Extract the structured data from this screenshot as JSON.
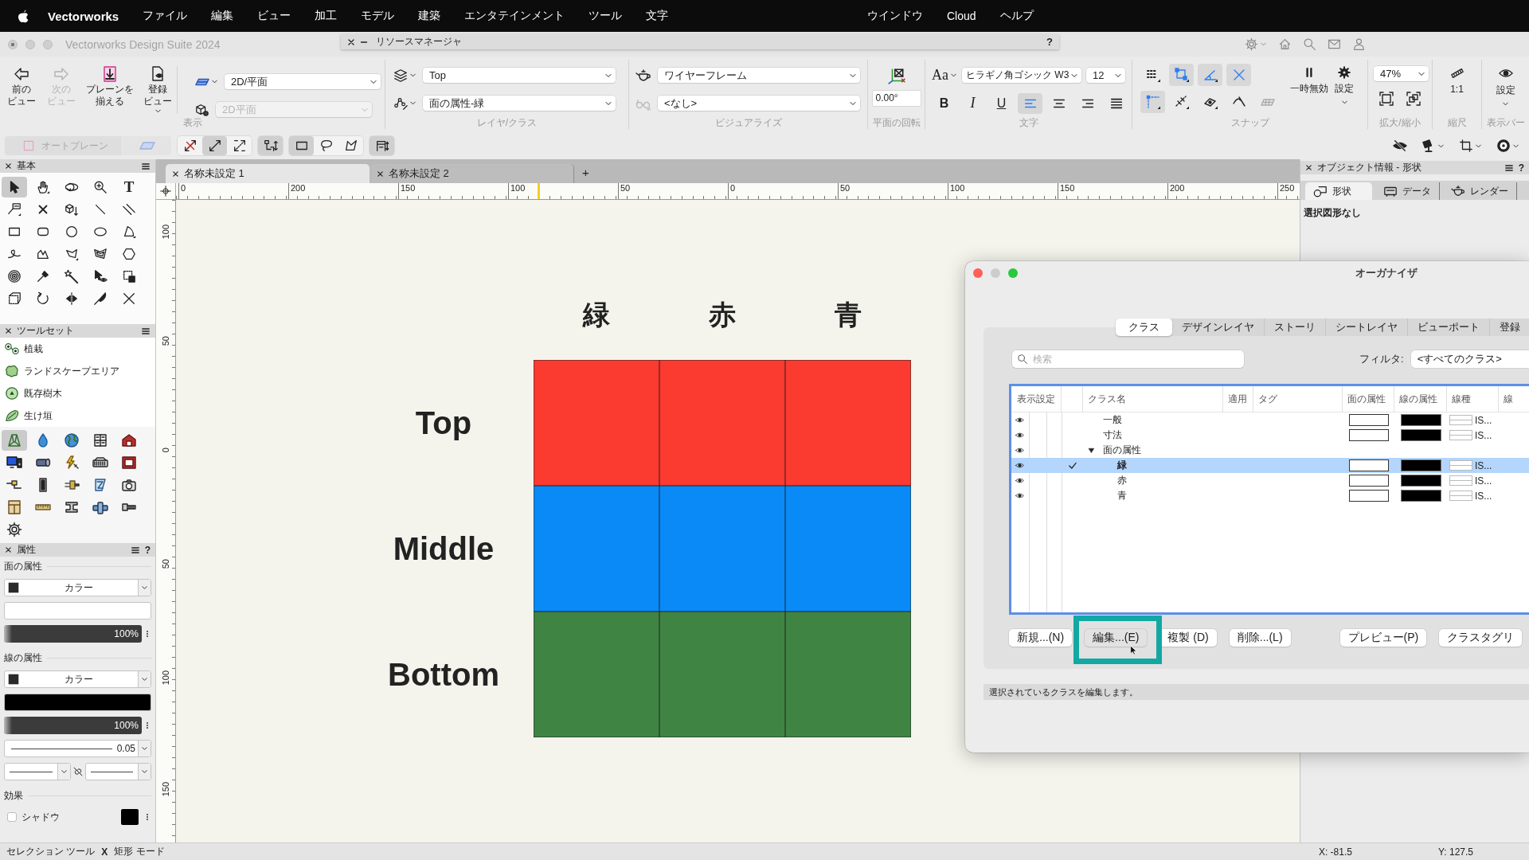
{
  "menubar": {
    "app": "Vectorworks",
    "items": [
      "ファイル",
      "編集",
      "ビュー",
      "加工",
      "モデル",
      "建築",
      "エンタテインメント",
      "ツール",
      "文字"
    ],
    "trailing_items": [
      "ウインドウ",
      "Cloud",
      "ヘルプ"
    ]
  },
  "window": {
    "title": "Vectorworks Design Suite 2024"
  },
  "resource_manager": {
    "title": "リソースマネージャ",
    "help": "?"
  },
  "toolbar": {
    "view": {
      "label": "表示",
      "buttons": [
        {
          "kind": "back",
          "label": "前のビュー",
          "disabled": false
        },
        {
          "kind": "forward",
          "label": "次のビュー",
          "disabled": true
        },
        {
          "kind": "align_plane",
          "label": "プレーンを揃える",
          "disabled": false
        },
        {
          "kind": "saved_view",
          "label": "登録ビュー",
          "disabled": false
        }
      ],
      "plane": {
        "value": "2D/平面",
        "disabled": false
      },
      "render_plane": {
        "value": "2D平面",
        "disabled": true
      }
    },
    "layer_class": {
      "label": "レイヤ/クラス",
      "layer": "Top",
      "class": "面の属性-緑"
    },
    "visualize": {
      "label": "ビジュアライズ",
      "render_mode": "ワイヤーフレーム",
      "palette": "<なし>"
    },
    "rotation": {
      "label": "平面の回転",
      "value": "0.00°"
    },
    "text": {
      "label": "文字",
      "font_button": "Aa",
      "font": "ヒラギノ角ゴシック W3",
      "size": "12",
      "styles": [
        {
          "kind": "bold",
          "label": "B"
        },
        {
          "kind": "italic",
          "label": "I"
        },
        {
          "kind": "underline",
          "label": "U"
        }
      ],
      "alignments": [
        {
          "kind": "left",
          "selected": true
        },
        {
          "kind": "center",
          "selected": false
        },
        {
          "kind": "right",
          "selected": false
        },
        {
          "kind": "justify",
          "selected": false
        }
      ]
    },
    "snap": {
      "label": "スナップ",
      "rows": [
        {
          "buttons": [
            {
              "kind": "grid",
              "on": false
            },
            {
              "kind": "object",
              "on": true
            },
            {
              "kind": "angle",
              "on": true
            },
            {
              "kind": "intersection",
              "on": true
            }
          ]
        },
        {
          "buttons": [
            {
              "kind": "smart_point",
              "on": true
            },
            {
              "kind": "distance",
              "on": false
            },
            {
              "kind": "surface",
              "on": false
            },
            {
              "kind": "tangent",
              "on": false
            },
            {
              "kind": "working_plane",
              "on": false
            }
          ]
        }
      ],
      "pause": "一時無効",
      "settings": "設定"
    },
    "zoom": {
      "label": "拡大/縮小",
      "value": "47%"
    },
    "scale": {
      "label": "縮尺",
      "value": "1:1"
    },
    "view_bar": {
      "label": "表示バー",
      "settings": "設定"
    }
  },
  "mode_bar": {
    "auto_plane": {
      "label": "オートプレーン",
      "disabled": true
    },
    "groups": [
      {
        "modes": [
          {
            "kind": "no_scale",
            "selected": false
          },
          {
            "kind": "single_scale",
            "selected": true
          },
          {
            "kind": "free_scale",
            "selected": false
          }
        ]
      },
      {
        "modes": [
          {
            "kind": "snap_parts",
            "selected": true
          }
        ]
      },
      {
        "modes": [
          {
            "kind": "rect_select",
            "selected": true
          },
          {
            "kind": "lasso",
            "selected": false
          },
          {
            "kind": "poly_select",
            "selected": false
          }
        ]
      },
      {
        "modes": [
          {
            "kind": "plane_mode",
            "selected": true
          }
        ]
      }
    ]
  },
  "palettes": {
    "basic": {
      "title": "基本",
      "tools": [
        {
          "kind": "selection",
          "selected": true
        },
        {
          "kind": "pan",
          "selected": false
        },
        {
          "kind": "flyover",
          "selected": false
        },
        {
          "kind": "zoom",
          "selected": false
        },
        {
          "kind": "text",
          "glyph": "T",
          "selected": false
        },
        {
          "kind": "callout",
          "selected": false
        },
        {
          "kind": "locus",
          "selected": false
        },
        {
          "kind": "pushpull",
          "selected": false
        },
        {
          "kind": "line",
          "selected": false
        },
        {
          "kind": "double_line",
          "selected": false
        },
        {
          "kind": "rectangle",
          "selected": false
        },
        {
          "kind": "rounded_rectangle",
          "selected": false
        },
        {
          "kind": "circle",
          "selected": false
        },
        {
          "kind": "oval",
          "selected": false
        },
        {
          "kind": "arc",
          "selected": false
        },
        {
          "kind": "freehand",
          "selected": false
        },
        {
          "kind": "polyline",
          "selected": false
        },
        {
          "kind": "polygon",
          "selected": false
        },
        {
          "kind": "double_polygon",
          "selected": false
        },
        {
          "kind": "regular_polygon",
          "selected": false
        },
        {
          "kind": "spiral",
          "selected": false
        },
        {
          "kind": "eyedropper",
          "selected": false
        },
        {
          "kind": "attribute_mapping",
          "selected": false
        },
        {
          "kind": "visibility",
          "selected": false
        },
        {
          "kind": "reshape",
          "selected": false
        },
        {
          "kind": "transform",
          "selected": false
        },
        {
          "kind": "rotate",
          "selected": false
        },
        {
          "kind": "mirror",
          "selected": false
        },
        {
          "kind": "split",
          "selected": false
        },
        {
          "kind": "connect",
          "selected": false
        }
      ]
    },
    "tool_sets": {
      "title": "ツールセット",
      "items": [
        {
          "kind": "planting",
          "label": "植栽",
          "selected": false
        },
        {
          "kind": "landscape_area",
          "label": "ランドスケープエリア",
          "selected": false
        },
        {
          "kind": "existing_tree",
          "label": "既存樹木",
          "selected": false
        },
        {
          "kind": "hedge",
          "label": "生け垣",
          "selected": false
        }
      ],
      "sets": [
        {
          "kind": "landscape",
          "selected": true
        },
        {
          "kind": "water",
          "selected": false
        },
        {
          "kind": "globe",
          "selected": false
        },
        {
          "kind": "panel",
          "selected": false
        },
        {
          "kind": "barn",
          "selected": false
        },
        {
          "kind": "monitor",
          "selected": false
        },
        {
          "kind": "spotlight",
          "selected": false
        },
        {
          "kind": "lightning",
          "selected": false
        },
        {
          "kind": "truss",
          "selected": false
        },
        {
          "kind": "stage",
          "selected": false
        },
        {
          "kind": "cable",
          "selected": false
        },
        {
          "kind": "column",
          "selected": false
        },
        {
          "kind": "brush",
          "selected": false
        },
        {
          "kind": "z_tile",
          "selected": false
        },
        {
          "kind": "camera",
          "selected": false
        },
        {
          "kind": "cabinet",
          "selected": false
        },
        {
          "kind": "ruler",
          "selected": false
        },
        {
          "kind": "beam",
          "selected": false
        },
        {
          "kind": "pipe",
          "selected": false
        },
        {
          "kind": "bolt",
          "selected": false
        },
        {
          "kind": "gear",
          "selected": false
        }
      ]
    },
    "attributes": {
      "title": "属性",
      "help": "?",
      "fill": {
        "label": "面の属性",
        "type": "カラー",
        "color": "#ffffff",
        "opacity": {
          "level": 1,
          "reading": "100%"
        }
      },
      "pen": {
        "label": "線の属性",
        "type": "カラー",
        "color": "#000000",
        "opacity": {
          "level": 1,
          "reading": "100%"
        },
        "weight": "0.05"
      },
      "effects": {
        "label": "効果",
        "shadow": {
          "label": "シャドウ",
          "checked": false,
          "color": "#000000"
        }
      }
    }
  },
  "documents": {
    "tabs": [
      {
        "label": "名称未設定 1",
        "selected": true
      },
      {
        "label": "名称未設定 2",
        "selected": false
      }
    ],
    "add": "+"
  },
  "rulers": {
    "horizontal": [
      "0",
      "200",
      "150",
      "100",
      "50",
      "0",
      "50",
      "100",
      "150",
      "200",
      "250"
    ],
    "vertical": [
      "100",
      "50",
      "0",
      "50",
      "100",
      "150"
    ]
  },
  "canvas": {
    "columns": [
      "緑",
      "赤",
      "青"
    ],
    "rows": [
      {
        "label": "Top",
        "cells": [
          {
            "color": "#fb3a30"
          },
          {
            "color": "#fb3a30"
          },
          {
            "color": "#fb3a30"
          }
        ]
      },
      {
        "label": "Middle",
        "cells": [
          {
            "color": "#0a8af6"
          },
          {
            "color": "#0a8af6"
          },
          {
            "color": "#0a8af6"
          }
        ]
      },
      {
        "label": "Bottom",
        "cells": [
          {
            "color": "#3f8443"
          },
          {
            "color": "#3f8443"
          },
          {
            "color": "#3f8443"
          }
        ]
      }
    ]
  },
  "object_info": {
    "title": "オブジェクト情報 - 形状",
    "help": "?",
    "tabs": [
      {
        "kind": "shape",
        "label": "形状",
        "selected": true
      },
      {
        "kind": "data",
        "label": "データ",
        "selected": false
      },
      {
        "kind": "render",
        "label": "レンダー",
        "selected": false
      }
    ],
    "message": "選択図形なし"
  },
  "organizer": {
    "title": "オーガナイザ",
    "tabs": [
      {
        "label": "クラス",
        "selected": true
      },
      {
        "label": "デザインレイヤ",
        "selected": false
      },
      {
        "label": "ストーリ",
        "selected": false
      },
      {
        "label": "シートレイヤ",
        "selected": false
      },
      {
        "label": "ビューポート",
        "selected": false
      },
      {
        "label": "登録",
        "selected": false
      }
    ],
    "search": {
      "placeholder": "検索"
    },
    "filter": {
      "label": "フィルタ:",
      "value": "<すべてのクラス>"
    },
    "columns": [
      "表示設定",
      "クラス名",
      "適用",
      "タグ",
      "面の属性",
      "線の属性",
      "線種",
      "線"
    ],
    "classes": [
      {
        "name": "一般",
        "visible": true,
        "active": false,
        "selected": false,
        "line_type": "IS..."
      },
      {
        "name": "寸法",
        "visible": true,
        "active": false,
        "selected": false,
        "line_type": "IS..."
      },
      {
        "name": "面の属性",
        "visible": true,
        "active": false,
        "selected": false,
        "expanded": true,
        "children": [
          {
            "name": "緑",
            "visible": true,
            "active": true,
            "selected": true,
            "line_type": "IS..."
          },
          {
            "name": "赤",
            "visible": true,
            "active": false,
            "selected": false,
            "line_type": "IS..."
          },
          {
            "name": "青",
            "visible": true,
            "active": false,
            "selected": false,
            "line_type": "IS..."
          }
        ]
      }
    ],
    "buttons": [
      {
        "label": "新規...(N)",
        "highlighted": false
      },
      {
        "label": "編集...(E)",
        "highlighted": true
      },
      {
        "label": "複製 (D)",
        "highlighted": false
      },
      {
        "label": "削除...(L)",
        "highlighted": false
      }
    ],
    "side_buttons": [
      {
        "label": "プレビュー(P)",
        "highlighted": false
      },
      {
        "label": "クラスタグリ",
        "highlighted": false
      }
    ],
    "hint": "選択されているクラスを編集します。"
  },
  "status_bar": {
    "tool": "セレクション ツール",
    "separator": "X",
    "mode": "矩形 モード",
    "x": "X: -81.5",
    "y": "Y: 127.5"
  }
}
